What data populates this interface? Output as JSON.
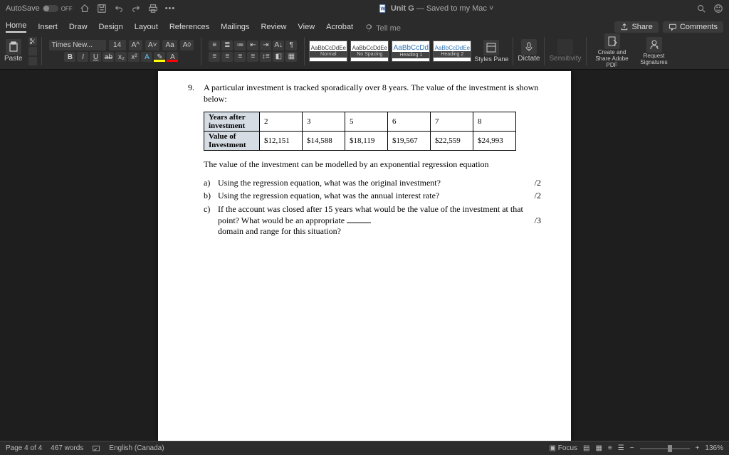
{
  "titlebar": {
    "autosave": "AutoSave",
    "autosave_state": "OFF",
    "doc_title": "Unit G",
    "save_state": "— Saved to my Mac"
  },
  "tabs": [
    "Home",
    "Insert",
    "Draw",
    "Design",
    "Layout",
    "References",
    "Mailings",
    "Review",
    "View",
    "Acrobat"
  ],
  "tellme": "Tell me",
  "share": "Share",
  "comments": "Comments",
  "ribbon": {
    "paste": "Paste",
    "font_name": "Times New...",
    "font_size": "14",
    "styles_label": "Styles Pane",
    "dictate": "Dictate",
    "sensitivity": "Sensitivity",
    "cshare": "Create and Share Adobe PDF",
    "request": "Request Signatures",
    "styles": [
      {
        "sample": "AaBbCcDdEe",
        "name": "Normal"
      },
      {
        "sample": "AaBbCcDdEe",
        "name": "No Spacing"
      },
      {
        "sample": "AaBbCcDd",
        "name": "Heading 1"
      },
      {
        "sample": "AaBbCcDdEe",
        "name": "Heading 2"
      }
    ]
  },
  "document": {
    "q_num": "9.",
    "q_text": "A particular investment is tracked sporadically over 8 years. The value of the investment is shown below:",
    "table": {
      "row1_header": "Years after investment",
      "row1": [
        "2",
        "3",
        "5",
        "6",
        "7",
        "8"
      ],
      "row2_header": "Value of Investment",
      "row2": [
        "$12,151",
        "$14,588",
        "$18,119",
        "$19,567",
        "$22,559",
        "$24,993"
      ]
    },
    "model_text": "The value of the investment can be modelled by an exponential regression equation",
    "parts": [
      {
        "lab": "a)",
        "text": "Using the regression equation, what was the original investment?",
        "marks": "/2",
        "blank": false
      },
      {
        "lab": "b)",
        "text": "Using the regression equation, what was the annual interest rate?",
        "marks": "/2",
        "blank": false
      },
      {
        "lab": "c)",
        "text": "If the account was closed after 15 years what would be the value of the investment at that point? What would be an appropriate",
        "marks": "/3",
        "blank": true,
        "text2": "domain and range for this situation?"
      }
    ]
  },
  "status": {
    "page": "Page 4 of 4",
    "words": "467 words",
    "lang": "English (Canada)",
    "focus": "Focus",
    "zoom": "136%"
  },
  "chart_data": {
    "type": "table",
    "title": "Investment value over time",
    "columns": [
      "Years after investment",
      "Value of Investment ($)"
    ],
    "rows": [
      [
        2,
        12151
      ],
      [
        3,
        14588
      ],
      [
        5,
        18119
      ],
      [
        6,
        19567
      ],
      [
        7,
        22559
      ],
      [
        8,
        24993
      ]
    ]
  }
}
